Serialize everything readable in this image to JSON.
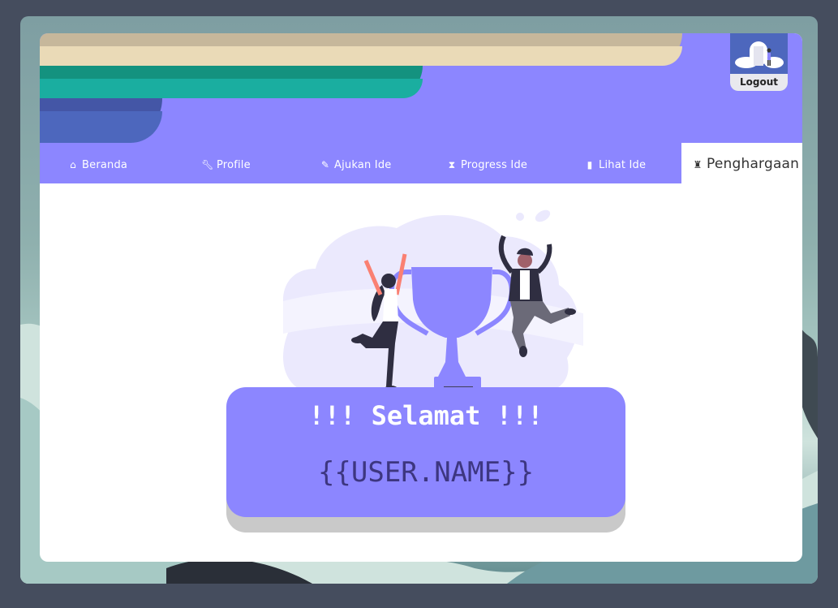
{
  "header": {
    "logout_label": "Logout",
    "logout_icon": "door-person-icon"
  },
  "nav": {
    "items": [
      {
        "label": "Beranda",
        "icon": "home-icon"
      },
      {
        "label": "Profile",
        "icon": "wrench-icon"
      },
      {
        "label": "Ajukan Ide",
        "icon": "edit-note-icon"
      },
      {
        "label": "Progress Ide",
        "icon": "hourglass-icon"
      },
      {
        "label": "Lihat Ide",
        "icon": "clipboard-icon"
      },
      {
        "label": "Penghargaan",
        "icon": "trophy-icon"
      }
    ],
    "active": "Penghargaan"
  },
  "congrats": {
    "title": "!!! Selamat !!!",
    "name": "{{USER.NAME}}"
  },
  "colors": {
    "primary": "#8c86ff",
    "page_bg": "#454d5e",
    "name_text": "#3d3680",
    "teal": "#1aaea0",
    "beige": "#eadab7"
  }
}
